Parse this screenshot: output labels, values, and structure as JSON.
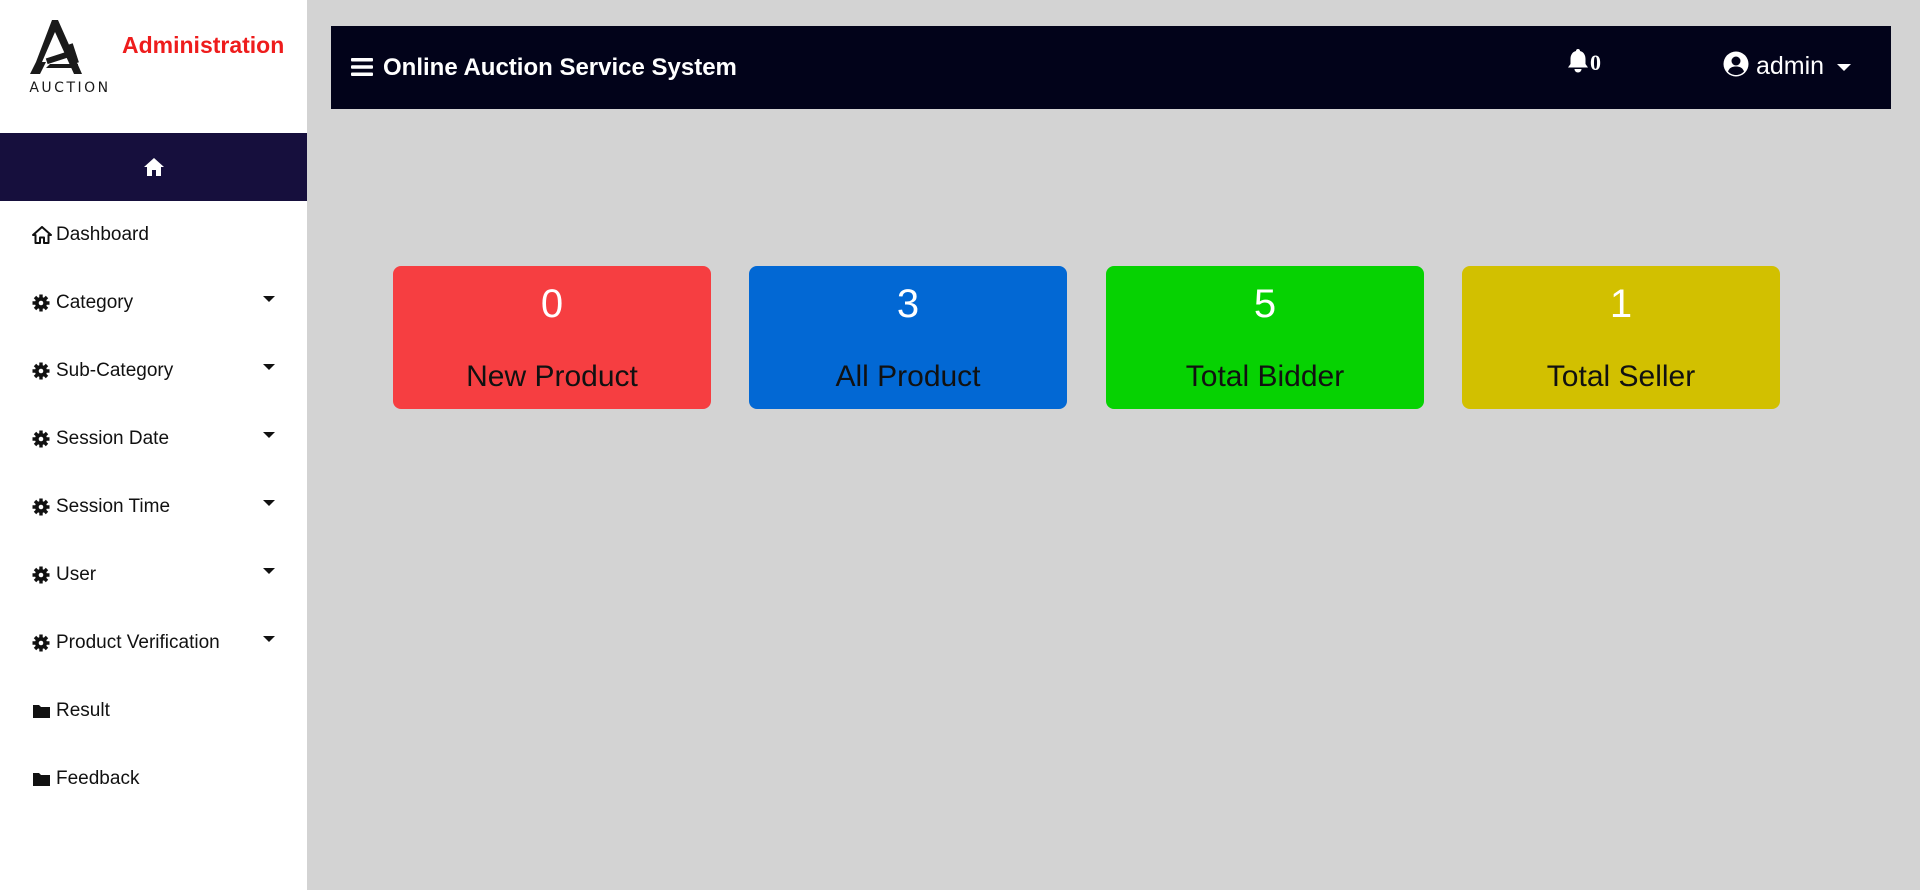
{
  "brand": {
    "logo_text": "AUCTION",
    "title": "Administration"
  },
  "home_bar": {
    "icon": "home-icon"
  },
  "sidebar": {
    "items": [
      {
        "label": "Dashboard",
        "icon": "home-icon",
        "has_dropdown": false
      },
      {
        "label": "Category",
        "icon": "gear-icon",
        "has_dropdown": true
      },
      {
        "label": "Sub-Category",
        "icon": "gear-icon",
        "has_dropdown": true
      },
      {
        "label": "Session Date",
        "icon": "gear-icon",
        "has_dropdown": true
      },
      {
        "label": "Session Time",
        "icon": "gear-icon",
        "has_dropdown": true
      },
      {
        "label": "User",
        "icon": "gear-icon",
        "has_dropdown": true
      },
      {
        "label": "Product Verification",
        "icon": "gear-icon",
        "has_dropdown": true
      },
      {
        "label": "Result",
        "icon": "folder-icon",
        "has_dropdown": false
      },
      {
        "label": "Feedback",
        "icon": "folder-icon",
        "has_dropdown": false
      }
    ]
  },
  "topbar": {
    "menu_icon": "hamburger-icon",
    "title": "Online Auction Service System",
    "notification_icon": "bell-icon",
    "notification_count": "0",
    "user_icon": "user-circle-icon",
    "user_name": "admin"
  },
  "stats": [
    {
      "value": "0",
      "label": "New Product",
      "color": "#f63e41"
    },
    {
      "value": "3",
      "label": "All Product",
      "color": "#0268d4"
    },
    {
      "value": "5",
      "label": "Total Bidder",
      "color": "#06d202"
    },
    {
      "value": "1",
      "label": "Total Seller",
      "color": "#d2c000"
    }
  ],
  "colors": {
    "page_background": "#d3d3d3",
    "topbar_background": "#02031a",
    "home_bar_background": "#160f3d",
    "brand_title": "#ee1c1c"
  }
}
